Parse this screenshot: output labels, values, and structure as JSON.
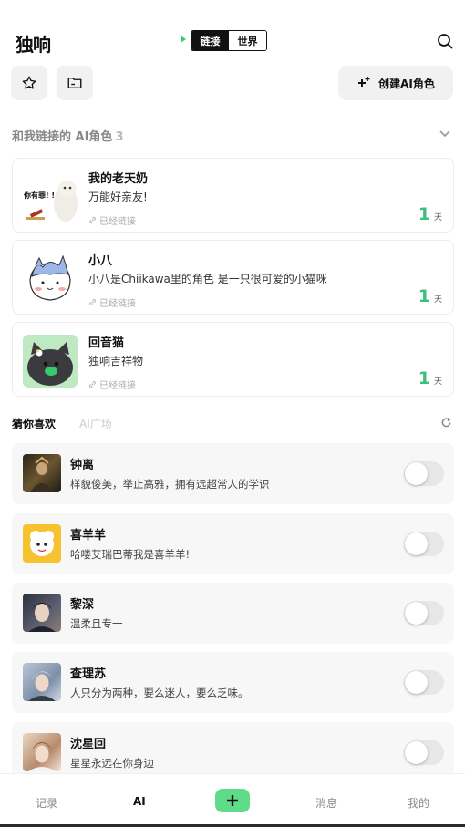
{
  "header": {
    "logo_text": "独响",
    "switch": {
      "tab_link": "链接",
      "tab_world": "世界"
    },
    "create_button_label": "创建AI角色"
  },
  "linked_section": {
    "title": "和我链接的 AI角色",
    "count": "3",
    "cards": [
      {
        "name": "我的老天奶",
        "desc": "万能好亲友!",
        "status": "已经链接",
        "days": "1",
        "days_unit": "天",
        "avatar_text": "你有罪! !"
      },
      {
        "name": "小八",
        "desc": "小八是Chiikawa里的角色 是一只很可爱的小猫咪",
        "status": "已经链接",
        "days": "1",
        "days_unit": "天"
      },
      {
        "name": "回音猫",
        "desc": "独响吉祥物",
        "status": "已经链接",
        "days": "1",
        "days_unit": "天"
      }
    ]
  },
  "guess_section": {
    "tab_guess": "猜你喜欢",
    "tab_plaza": "AI广场",
    "items": [
      {
        "name": "钟离",
        "desc": "样貌俊美，举止高雅，拥有远超常人的学识",
        "on": false
      },
      {
        "name": "喜羊羊",
        "desc": "哈喽艾瑞巴蒂我是喜羊羊!",
        "on": false
      },
      {
        "name": "黎深",
        "desc": "温柔且专一",
        "on": false
      },
      {
        "name": "查理苏",
        "desc": "人只分为两种，要么迷人，要么乏味。",
        "on": false
      },
      {
        "name": "沈星回",
        "desc": "星星永远在你身边",
        "on": false
      }
    ]
  },
  "bottom_nav": {
    "records": "记录",
    "ai": "AI",
    "messages": "消息",
    "mine": "我的"
  },
  "colors": {
    "accent_green": "#3bbf7a",
    "plus_green": "#5fdc8a"
  },
  "icons": [
    "search-icon",
    "star-icon",
    "folder-icon",
    "sparkle-plus-icon",
    "chevron-down-icon",
    "link-icon",
    "refresh-icon",
    "plus-icon"
  ]
}
